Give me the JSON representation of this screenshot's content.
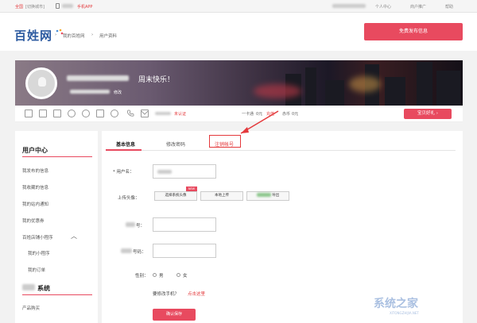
{
  "topbar": {
    "home": "全国",
    "switch_city": "[切换城市]",
    "mobile_app": "手机APP",
    "personal_center": "个人中心",
    "merchant": "商户推广",
    "help": "帮助"
  },
  "header": {
    "logo": "百姓网",
    "breadcrumb_home": "我的百姓网",
    "breadcrumb_current": "用户资料",
    "post_button": "免费发布信息"
  },
  "banner": {
    "greeting": "周末快乐！",
    "edit": "修改"
  },
  "strip": {
    "verify": "未认证",
    "wallet_label": "一卡通",
    "wallet_value": "0元",
    "recharge": "充值",
    "coin_label": "赤币",
    "coin_value": "0元",
    "share_button": "宝贝好礼"
  },
  "sidebar": {
    "title": "用户中心",
    "items": [
      "我发布的信息",
      "我收藏的信息",
      "我的站内通知",
      "我的优惠券",
      "百姓店铺小程序"
    ],
    "subitems": [
      "我的小程序",
      "我的订单"
    ],
    "system_title": "系统",
    "system_items": [
      "产品购买"
    ]
  },
  "tabs": [
    "基本信息",
    "修改密码",
    "注销帐号"
  ],
  "form": {
    "username_label": "* 用户名：",
    "avatar_label": "上传头像：",
    "pick_avatar": "选择系统头像",
    "new_badge": "NEW",
    "local_upload": "本地上传",
    "third_upload": "导出",
    "field3_label": "号：",
    "field4_label": "号码：",
    "gender_label": "性别：",
    "male": "男",
    "female": "女",
    "phone_note": "要修改手机？",
    "phone_link": "点击这里",
    "submit": "确认保存"
  },
  "watermark": {
    "title": "系统之家",
    "sub": "XITONGZHIJIA.NET"
  },
  "colors": {
    "accent": "#e84a5f",
    "link": "#e4393c"
  }
}
